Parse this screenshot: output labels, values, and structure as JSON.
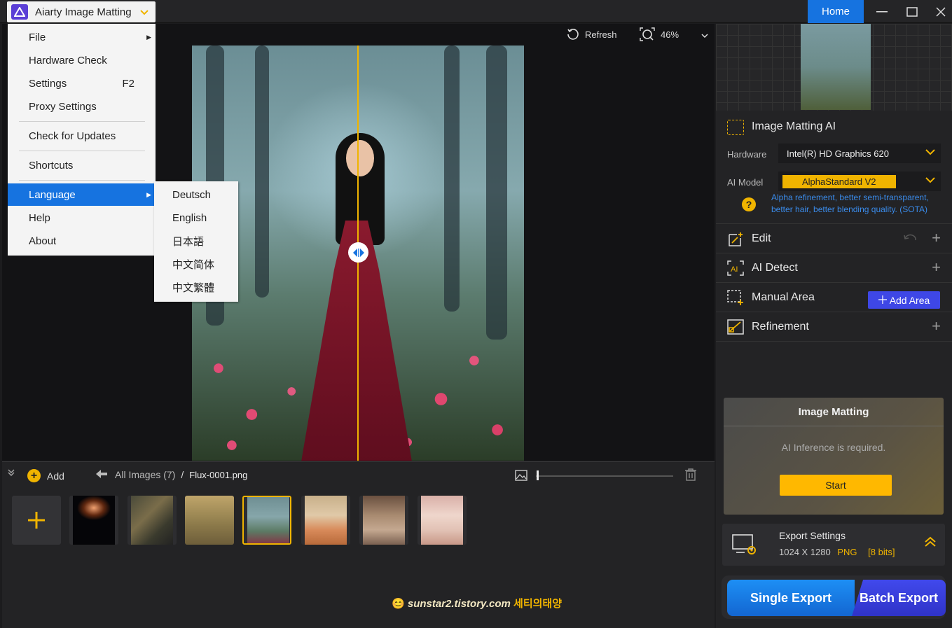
{
  "app": {
    "title": "Aiarty Image Matting"
  },
  "window": {
    "home": "Home"
  },
  "viewer": {
    "refresh": "Refresh",
    "zoom": "46%"
  },
  "menu": {
    "items": [
      {
        "label": "File",
        "shortcut": ""
      },
      {
        "label": "Hardware Check",
        "shortcut": ""
      },
      {
        "label": "Settings",
        "shortcut": "F2"
      },
      {
        "label": "Proxy Settings",
        "shortcut": ""
      },
      {
        "label": "Check for Updates",
        "shortcut": ""
      },
      {
        "label": "Shortcuts",
        "shortcut": ""
      },
      {
        "label": "Language",
        "shortcut": ""
      },
      {
        "label": "Help",
        "shortcut": ""
      },
      {
        "label": "About",
        "shortcut": ""
      }
    ],
    "languages": [
      "Deutsch",
      "English",
      "日本語",
      "中文简体",
      "中文繁體"
    ]
  },
  "filmstrip": {
    "add": "Add",
    "breadcrumb_all": "All Images (7)",
    "breadcrumb_sep": "/",
    "current_file": "Flux-0001.png",
    "size_slider": 0.02
  },
  "watermark": {
    "text": "sunstar2.tistory.com",
    "korean": "세티의태양"
  },
  "panel": {
    "matting_ai": "Image Matting AI",
    "hardware_label": "Hardware",
    "hardware_value": "Intel(R) HD Graphics 620",
    "model_label": "AI Model",
    "model_value": "AlphaStandard  V2",
    "model_desc": "Alpha refinement, better semi-transparent, better hair, better blending quality. (SOTA)",
    "edit": "Edit",
    "ai_detect": "AI Detect",
    "manual_area": "Manual Area",
    "add_area": "Add Area",
    "refinement": "Refinement",
    "matting_title": "Image Matting",
    "matting_text": "AI Inference is required.",
    "start": "Start",
    "export_title": "Export Settings",
    "export_size": "1024 X 1280",
    "export_format": "PNG",
    "export_bits": "[8 bits]",
    "single_export": "Single Export",
    "batch_export": "Batch Export"
  },
  "colors": {
    "accent": "#f0b400",
    "blue": "#1673e0",
    "indigo": "#3e47e6"
  }
}
